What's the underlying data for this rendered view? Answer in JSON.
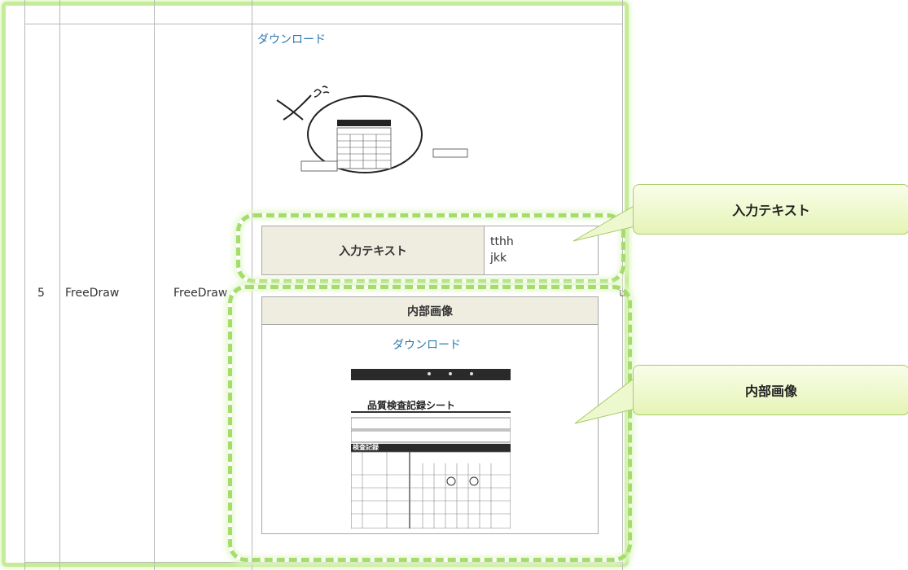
{
  "row": {
    "number": "5",
    "col2": "FreeDraw",
    "col3": "FreeDraw",
    "trailing": "u"
  },
  "top_cell": {
    "download_label": "ダウンロード"
  },
  "input_text_table": {
    "label": "入力テキスト",
    "value_line1": "tthh",
    "value_line2": "jkk"
  },
  "inner_image_table": {
    "header": "内部画像",
    "download_label": "ダウンロード",
    "sheet_title": "品質検査記録シート",
    "section_label": "検査記録"
  },
  "callouts": {
    "input_text": "入力テキスト",
    "inner_image": "内部画像"
  },
  "colors": {
    "highlight_green": "#a5dc6c",
    "link_blue": "#2a7ab0",
    "label_bg": "#efede0"
  }
}
